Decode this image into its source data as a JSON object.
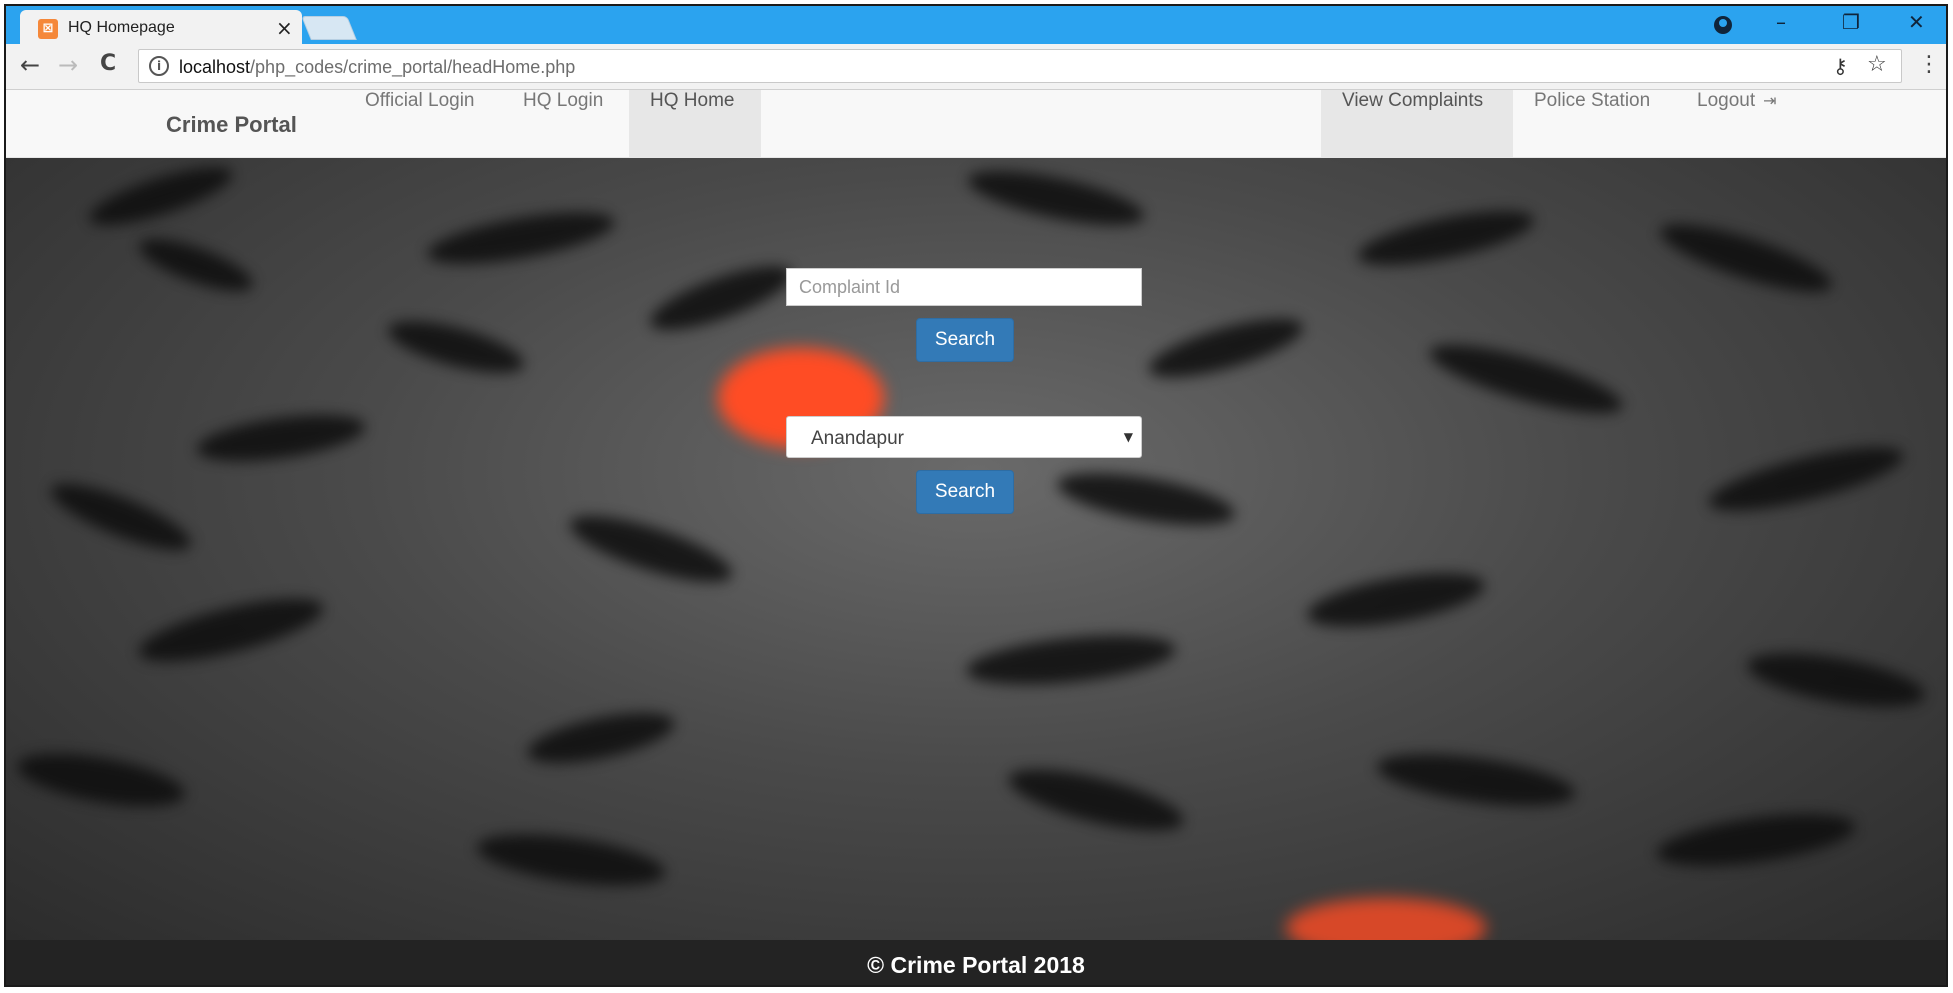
{
  "browser": {
    "tab_title": "HQ Homepage",
    "tab_close": "×",
    "favicon": "xampp-icon",
    "url_host": "localhost",
    "url_path": "/php_codes/crime_portal/headHome.php",
    "window_controls": {
      "minimize": "–",
      "restore": "❐",
      "close": "✕"
    },
    "nav": {
      "back": "←",
      "forward": "→",
      "reload": "C"
    },
    "accent_color": "#2ba3ef"
  },
  "navbar": {
    "brand": "Crime Portal",
    "left_links": [
      "Official Login",
      "HQ Login",
      "HQ Home"
    ],
    "active_left": "HQ Home",
    "right_links": [
      "View Complaints",
      "Police Station",
      "Logout"
    ],
    "active_right": "View Complaints"
  },
  "search": {
    "complaint_placeholder": "Complaint Id",
    "search_button_1": "Search",
    "station_selected": "Anandapur",
    "search_button_2": "Search",
    "button_color": "#337ab7"
  },
  "footer": {
    "text": "© Crime Portal 2018"
  }
}
